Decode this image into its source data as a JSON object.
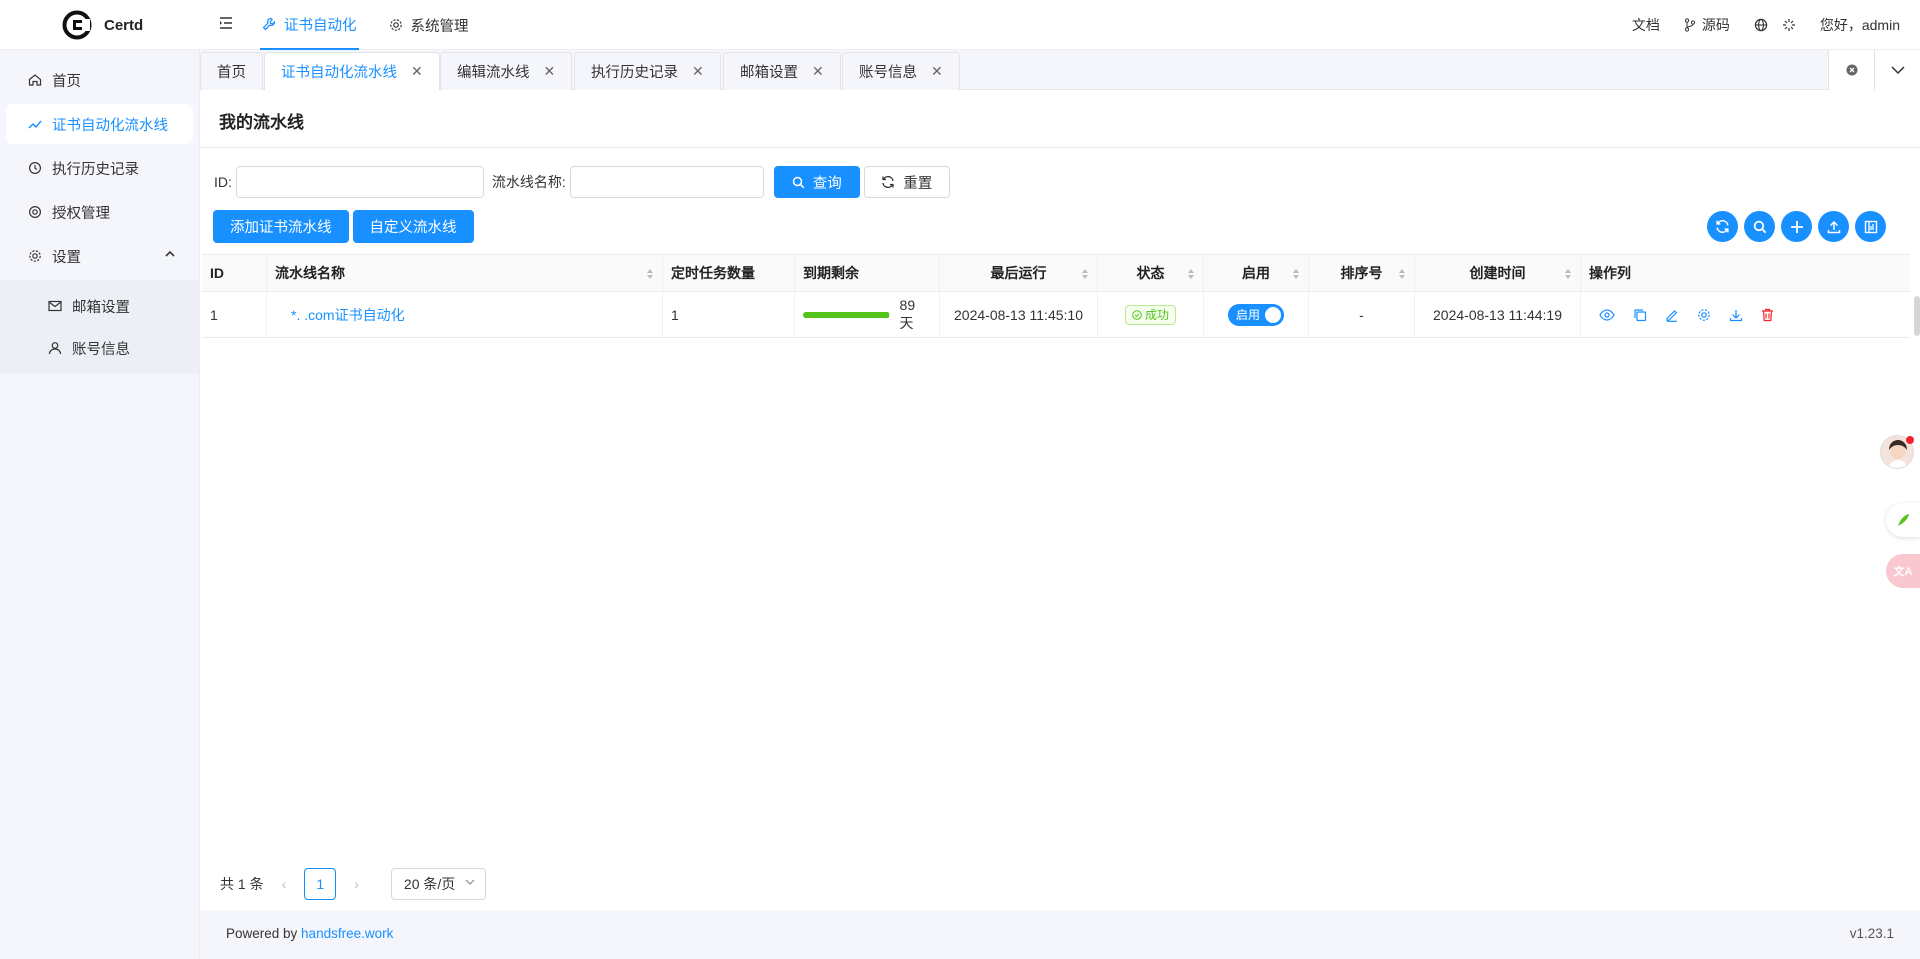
{
  "app": {
    "name": "Certd"
  },
  "header": {
    "nav": [
      {
        "label": "证书自动化",
        "active": true
      },
      {
        "label": "系统管理",
        "active": false
      }
    ],
    "docs_label": "文档",
    "source_label": "源码",
    "greeting": "您好，admin"
  },
  "sidebar": {
    "items": [
      {
        "label": "首页"
      },
      {
        "label": "证书自动化流水线"
      },
      {
        "label": "执行历史记录"
      },
      {
        "label": "授权管理"
      },
      {
        "label": "设置"
      }
    ],
    "settings_sub": [
      {
        "label": "邮箱设置"
      },
      {
        "label": "账号信息"
      }
    ]
  },
  "tabs": [
    {
      "label": "首页"
    },
    {
      "label": "证书自动化流水线"
    },
    {
      "label": "编辑流水线"
    },
    {
      "label": "执行历史记录"
    },
    {
      "label": "邮箱设置"
    },
    {
      "label": "账号信息"
    }
  ],
  "page": {
    "title": "我的流水线"
  },
  "search": {
    "id_label": "ID:",
    "name_label": "流水线名称:",
    "id_value": "",
    "name_value": "",
    "query_label": "查询",
    "reset_label": "重置"
  },
  "actions": {
    "add_label": "添加证书流水线",
    "custom_label": "自定义流水线"
  },
  "table": {
    "columns": [
      "ID",
      "流水线名称",
      "定时任务数量",
      "到期剩余",
      "最后运行",
      "状态",
      "启用",
      "排序号",
      "创建时间",
      "操作列"
    ],
    "rows": [
      {
        "id": "1",
        "name": "*.        .com证书自动化",
        "task_count": "1",
        "remaining_fraction": 0.99,
        "remaining_text": "89 天",
        "last_run": "2024-08-13 11:45:10",
        "status": "成功",
        "enabled_label": "启用",
        "sort": "-",
        "created": "2024-08-13 11:44:19"
      }
    ]
  },
  "pagination": {
    "total": "共 1 条",
    "current": "1",
    "page_size": "20 条/页"
  },
  "footer": {
    "powered_prefix": "Powered by ",
    "powered_link": "handsfree.work",
    "version": "v1.23.1"
  },
  "colors": {
    "primary": "#1890ff",
    "success": "#52c41a",
    "danger": "#f5222d"
  }
}
